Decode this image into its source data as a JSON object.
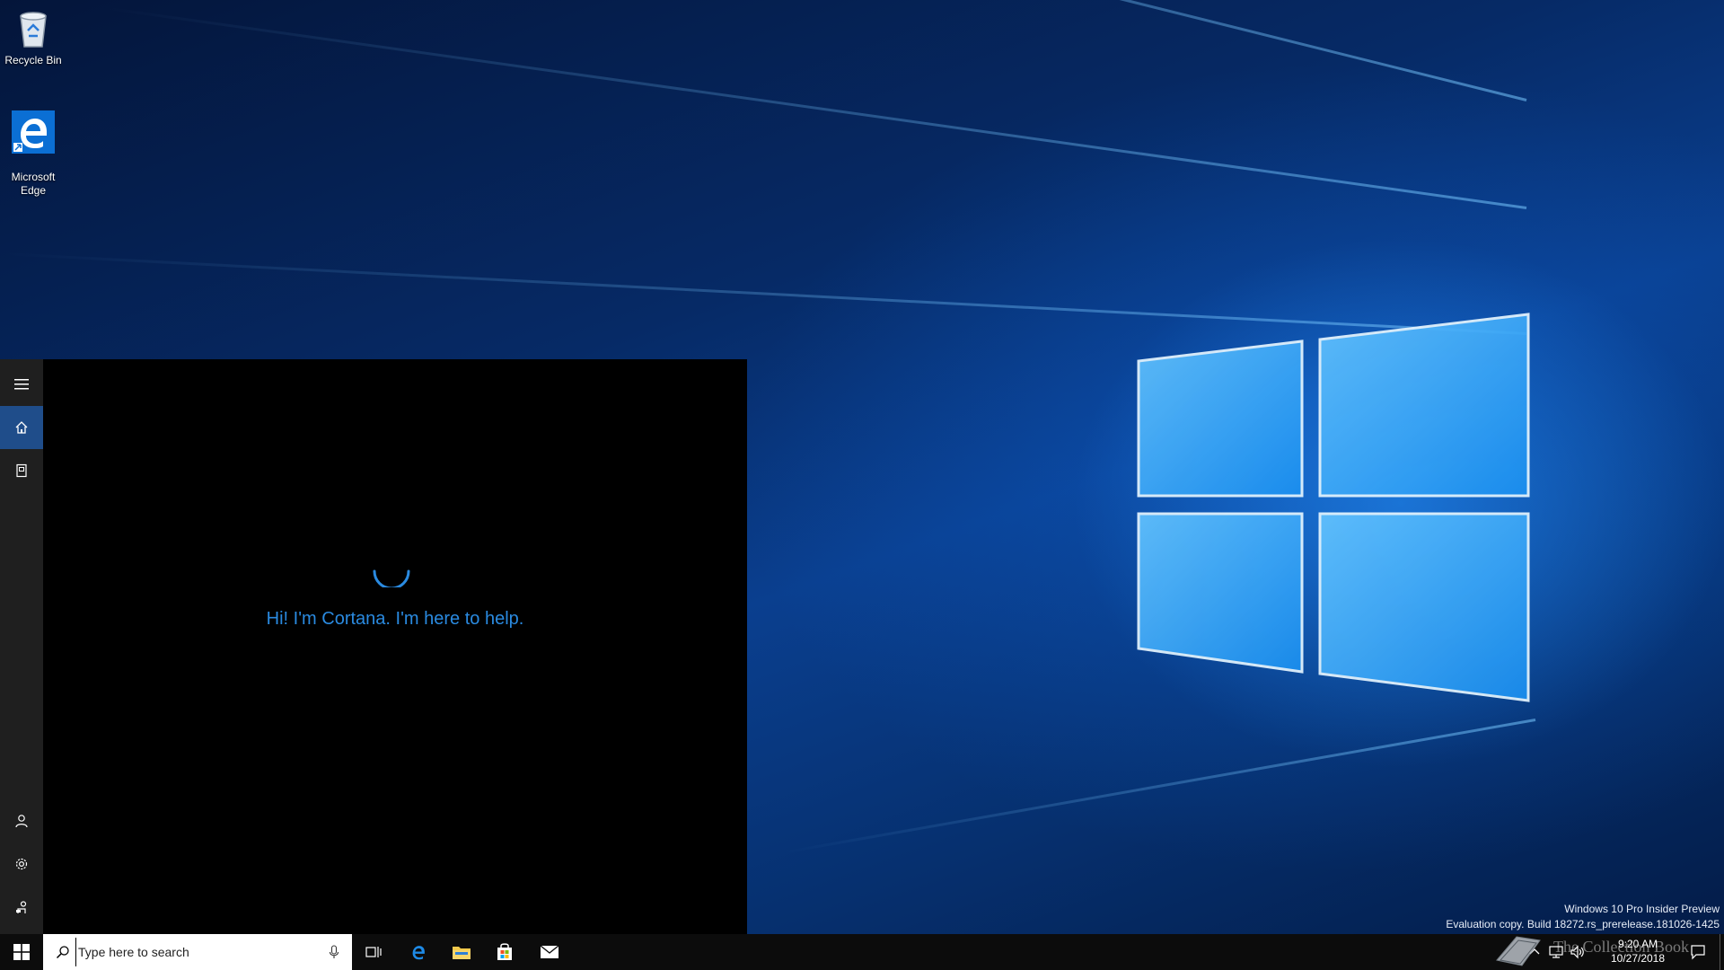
{
  "desktop": {
    "icons": [
      {
        "label": "Recycle Bin",
        "icon": "recycle-bin-icon"
      },
      {
        "label": "Microsoft\nEdge",
        "icon": "edge-icon"
      }
    ]
  },
  "cortana": {
    "greeting": "Hi! I'm Cortana. I'm here to help.",
    "rail": [
      {
        "icon": "hamburger-menu-icon"
      },
      {
        "icon": "home-icon",
        "active": true
      },
      {
        "icon": "notebook-icon"
      },
      {
        "icon": "account-icon"
      },
      {
        "icon": "settings-gear-icon"
      },
      {
        "icon": "feedback-icon"
      }
    ],
    "accent": "#2a8ae0"
  },
  "watermark": {
    "line1": "Windows 10 Pro Insider Preview",
    "line2": "Evaluation copy. Build 18272.rs_prerelease.181026-1425"
  },
  "taskbar": {
    "search_placeholder": "Type here to search",
    "pinned": [
      "task-view-icon",
      "edge-icon",
      "file-explorer-icon",
      "store-icon",
      "mail-icon"
    ],
    "clock_time": "9:20 AM",
    "clock_date": "10/27/2018",
    "brand_text": "The Collection Book"
  }
}
